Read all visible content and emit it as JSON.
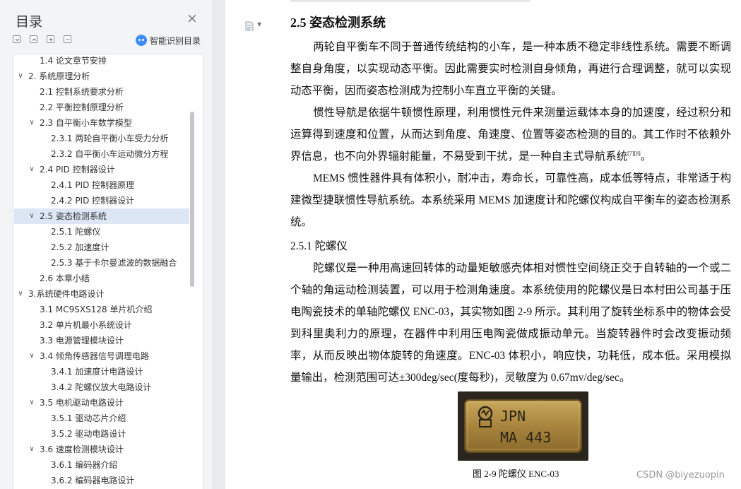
{
  "sidebar": {
    "title": "目录",
    "ai_label": "智能识别目录",
    "toc": [
      {
        "label": "1.4 论文章节安排",
        "level": 2,
        "chevron": ""
      },
      {
        "label": "2. 系统原理分析",
        "level": 1,
        "chevron": "expanded"
      },
      {
        "label": "2.1 控制系统要求分析",
        "level": 2,
        "chevron": ""
      },
      {
        "label": "2.2 平衡控制原理分析",
        "level": 2,
        "chevron": ""
      },
      {
        "label": "2.3 自平衡小车数学模型",
        "level": 2,
        "chevron": "expanded"
      },
      {
        "label": "2.3.1 两轮自平衡小车受力分析",
        "level": 3,
        "chevron": ""
      },
      {
        "label": "2.3.2 自平衡小车运动微分方程",
        "level": 3,
        "chevron": ""
      },
      {
        "label": "2.4 PID 控制器设计",
        "level": 2,
        "chevron": "expanded"
      },
      {
        "label": "2.4.1 PID 控制器原理",
        "level": 3,
        "chevron": ""
      },
      {
        "label": "2.4.2 PID 控制器设计",
        "level": 3,
        "chevron": ""
      },
      {
        "label": "2.5 姿态检测系统",
        "level": 2,
        "chevron": "expanded",
        "active": true
      },
      {
        "label": "2.5.1 陀螺仪",
        "level": 3,
        "chevron": ""
      },
      {
        "label": "2.5.2 加速度计",
        "level": 3,
        "chevron": ""
      },
      {
        "label": "2.5.3 基于卡尔曼滤波的数据融合",
        "level": 3,
        "chevron": ""
      },
      {
        "label": "2.6 本章小结",
        "level": 2,
        "chevron": ""
      },
      {
        "label": "3.系统硬件电路设计",
        "level": 1,
        "chevron": "expanded"
      },
      {
        "label": "3.1 MC9SXS128 单片机介绍",
        "level": 2,
        "chevron": ""
      },
      {
        "label": "3.2 单片机最小系统设计",
        "level": 2,
        "chevron": ""
      },
      {
        "label": "3.3 电源管理模块设计",
        "level": 2,
        "chevron": ""
      },
      {
        "label": "3.4 倾角传感器信号调理电路",
        "level": 2,
        "chevron": "expanded"
      },
      {
        "label": "3.4.1 加速度计电路设计",
        "level": 3,
        "chevron": ""
      },
      {
        "label": "3.4.2 陀螺仪放大电路设计",
        "level": 3,
        "chevron": ""
      },
      {
        "label": "3.5 电机驱动电路设计",
        "level": 2,
        "chevron": "expanded"
      },
      {
        "label": "3.5.1 驱动芯片介绍",
        "level": 3,
        "chevron": ""
      },
      {
        "label": "3.5.2 驱动电路设计",
        "level": 3,
        "chevron": ""
      },
      {
        "label": "3.6 速度检测模块设计",
        "level": 2,
        "chevron": "expanded"
      },
      {
        "label": "3.6.1 编码器介绍",
        "level": 3,
        "chevron": ""
      },
      {
        "label": "3.6.2 编码器电路设计",
        "level": 3,
        "chevron": ""
      }
    ]
  },
  "document": {
    "section_heading": "2.5 姿态检测系统",
    "paragraphs": [
      "两轮自平衡车不同于普通传统结构的小车，是一种本质不稳定非线性系统。需要不断调整自身角度，以实现动态平衡。因此需要实时检测自身倾角，再进行合理调整，就可以实现动态平衡，因而姿态检测成为控制小车直立平衡的关键。",
      "惯性导航是依据牛顿惯性原理，利用惯性元件来测量运载体本身的加速度，经过积分和运算得到速度和位置，从而达到角度、角速度、位置等姿态检测的目的。其工作时不依赖外界信息，也不向外界辐射能量，不易受到干扰，是一种自主式导航系统",
      "MEMS 惯性器件具有体积小，耐冲击，寿命长，可靠性高，成本低等特点，非常适于构建微型捷联惯性导航系统。本系统采用 MEMS 加速度计和陀螺仪构成自平衡车的姿态检测系统。"
    ],
    "citation": "[7][8]",
    "citation_tail": "。",
    "subsection_heading": "2.5.1 陀螺仪",
    "gyro_paragraph": "陀螺仪是一种用高速回转体的动量矩敏感壳体相对惯性空间绕正交于自转轴的一个或二个轴的角运动检测装置，可以用于检测角速度。本系统使用的陀螺仪是日本村田公司基于压电陶瓷技术的单轴陀螺仪 ENC-03，其实物如图 2-9 所示。其利用了旋转坐标系中的物体会受到科里奥利力的原理，在器件中利用压电陶瓷做成振动单元。当旋转器件时会改变振动频率，从而反映出物体旋转的角速度。ENC-03 体积小，响应快，功耗低，成本低。采用模拟量输出，检测范围可达±300deg/sec(度每秒)，灵敏度为 0.67mv/deg/sec。",
    "figure": {
      "chip_line1": "JPN",
      "chip_line2": "MA 443",
      "caption": "图 2-9  陀螺仪 ENC-03"
    },
    "watermark": "CSDN @biyezuopin"
  }
}
